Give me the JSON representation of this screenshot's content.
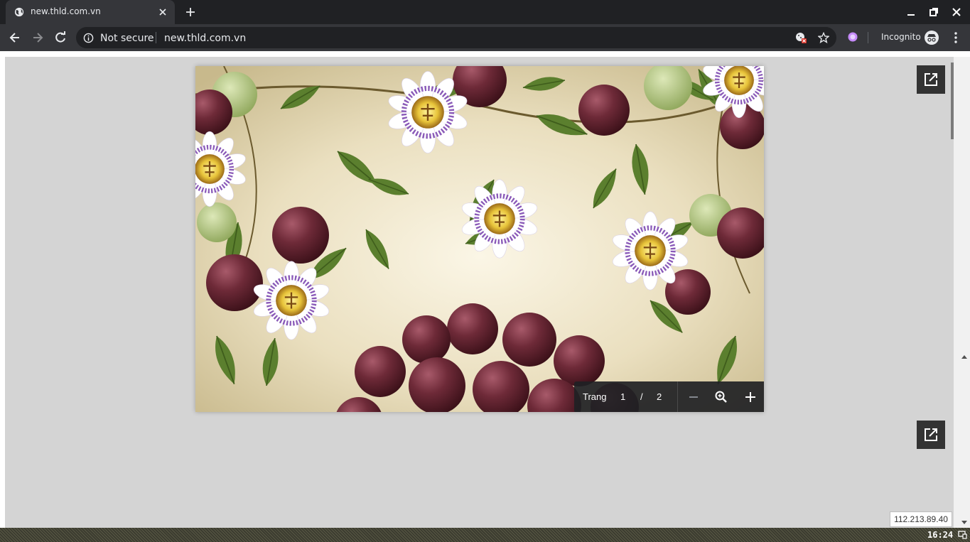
{
  "browser": {
    "tab": {
      "title": "new.thld.com.vn",
      "favicon": "globe-icon"
    },
    "window_controls": [
      "minimize-icon",
      "restore-icon",
      "close-icon"
    ]
  },
  "toolbar": {
    "security_label": "Not secure",
    "url": "new.thld.com.vn",
    "incognito_label": "Incognito"
  },
  "pdf_viewer": {
    "page_label": "Trang",
    "current_page": "1",
    "page_separator": "/",
    "total_pages": "2",
    "zoom_icons": [
      "minus-icon",
      "zoom-in-icon",
      "plus-icon"
    ]
  },
  "tooltip": {
    "ip": "112.213.89.40"
  },
  "taskbar": {
    "clock": "16:24"
  },
  "colors": {
    "chrome_dark": "#202124",
    "chrome_toolbar": "#35363a",
    "pdf_background": "#d4d4d4",
    "popout_button": "#333333"
  }
}
